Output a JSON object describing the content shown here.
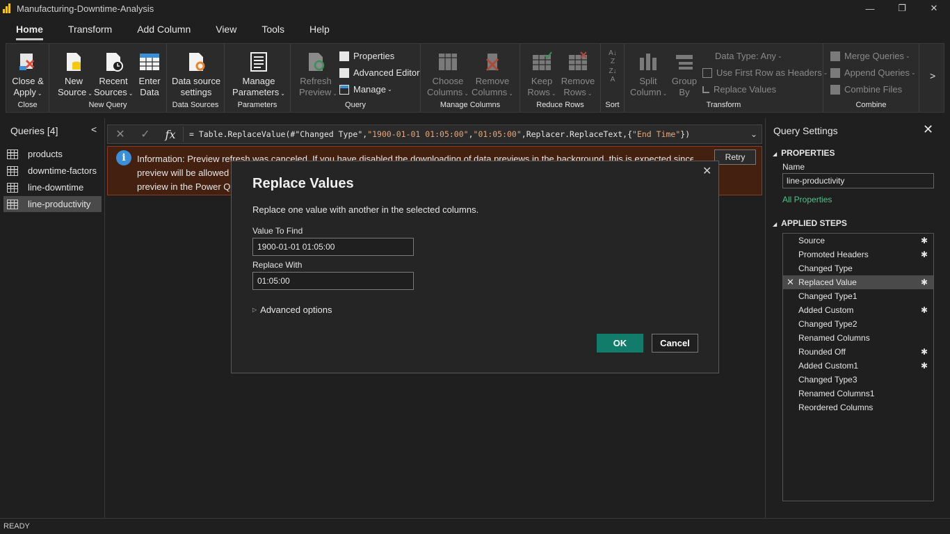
{
  "app": {
    "title": "Manufacturing-Downtime-Analysis",
    "minimize": "—",
    "restore": "❐",
    "close": "✕"
  },
  "menu_tabs": [
    "Home",
    "Transform",
    "Add Column",
    "View",
    "Tools",
    "Help"
  ],
  "ribbon": {
    "close": {
      "close_apply": "Close &",
      "close_apply2": "Apply",
      "label": "Close"
    },
    "new_query": {
      "new_source": "New",
      "new_source2": "Source",
      "recent_sources": "Recent",
      "recent_sources2": "Sources",
      "enter_data": "Enter",
      "enter_data2": "Data",
      "label": "New Query"
    },
    "data_sources": {
      "settings": "Data source",
      "settings2": "settings",
      "label": "Data Sources"
    },
    "parameters": {
      "manage": "Manage",
      "manage2": "Parameters",
      "label": "Parameters"
    },
    "query": {
      "refresh": "Refresh",
      "refresh2": "Preview",
      "properties": "Properties",
      "advanced_editor": "Advanced Editor",
      "manage": "Manage",
      "label": "Query"
    },
    "manage_columns": {
      "choose": "Choose",
      "choose2": "Columns",
      "remove": "Remove",
      "remove2": "Columns",
      "label": "Manage Columns"
    },
    "reduce_rows": {
      "keep": "Keep",
      "keep2": "Rows",
      "remove": "Remove",
      "remove2": "Rows",
      "label": "Reduce Rows"
    },
    "sort": {
      "label": "Sort"
    },
    "transform": {
      "split": "Split",
      "split2": "Column",
      "group": "Group",
      "group2": "By",
      "data_type": "Data Type: Any",
      "first_row": "Use First Row as Headers",
      "replace": "Replace Values",
      "label": "Transform"
    },
    "combine": {
      "merge": "Merge Queries",
      "append": "Append Queries",
      "files": "Combine Files",
      "label": "Combine"
    },
    "scroll": ">"
  },
  "formula_bar": {
    "cancel": "✕",
    "commit": "✓",
    "fx": "fx",
    "parts": [
      "= Table.ReplaceValue(#\"Changed Type\",",
      "\"1900-01-01 01:05:00\"",
      ",",
      "\"01:05:00\"",
      ",Replacer.ReplaceText,{",
      "\"End Time\"",
      "})"
    ],
    "expand": "⌄"
  },
  "queries": {
    "title": "Queries [4]",
    "collapse": "<",
    "items": [
      "products",
      "downtime-factors",
      "line-downtime",
      "line-productivity"
    ]
  },
  "info_bar": {
    "line1": "Information: Preview refresh was canceled. If you have disabled the downloading of data previews in the background, this is expected since only one",
    "line2": "preview will be allowed to",
    "line3": "preview in the Power Que",
    "retry": "Retry",
    "icon": "i"
  },
  "query_settings": {
    "title": "Query Settings",
    "close": "✕",
    "properties_header": "PROPERTIES",
    "name_label": "Name",
    "name_value": "line-productivity",
    "all_properties": "All Properties",
    "steps_header": "APPLIED STEPS",
    "steps": [
      {
        "label": "Source",
        "gear": true
      },
      {
        "label": "Promoted Headers",
        "gear": true
      },
      {
        "label": "Changed Type",
        "gear": false
      },
      {
        "label": "Replaced Value",
        "gear": true,
        "selected": true
      },
      {
        "label": "Changed Type1",
        "gear": false
      },
      {
        "label": "Added Custom",
        "gear": true
      },
      {
        "label": "Changed Type2",
        "gear": false
      },
      {
        "label": "Renamed Columns",
        "gear": false
      },
      {
        "label": "Rounded Off",
        "gear": true
      },
      {
        "label": "Added Custom1",
        "gear": true
      },
      {
        "label": "Changed Type3",
        "gear": false
      },
      {
        "label": "Renamed Columns1",
        "gear": false
      },
      {
        "label": "Reordered Columns",
        "gear": false
      }
    ]
  },
  "dialog": {
    "title": "Replace Values",
    "description": "Replace one value with another in the selected columns.",
    "find_label": "Value To Find",
    "find_value": "1900-01-01 01:05:00",
    "replace_label": "Replace With",
    "replace_value": "01:05:00",
    "advanced": "Advanced options",
    "ok": "OK",
    "cancel": "Cancel",
    "close": "✕"
  },
  "status": "READY",
  "colors": {
    "accent": "#127c6b",
    "link": "#4cc38a",
    "info_bg": "#442011"
  }
}
